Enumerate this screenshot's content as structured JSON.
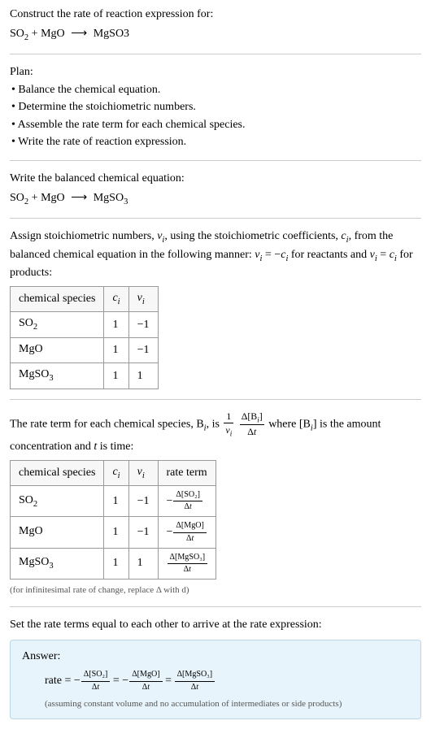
{
  "prompt": {
    "line1": "Construct the rate of reaction expression for:",
    "equation_lhs1": "SO",
    "equation_lhs1_sub": "2",
    "plus": " + ",
    "equation_lhs2": "MgO",
    "arrow": "⟶",
    "equation_rhs": "MgSO3"
  },
  "plan": {
    "heading": "Plan:",
    "bullets": [
      "• Balance the chemical equation.",
      "• Determine the stoichiometric numbers.",
      "• Assemble the rate term for each chemical species.",
      "• Write the rate of reaction expression."
    ]
  },
  "balanced": {
    "heading": "Write the balanced chemical equation:",
    "lhs1": "SO",
    "lhs1_sub": "2",
    "plus": " + ",
    "lhs2": "MgO",
    "arrow": "⟶",
    "rhs": "MgSO",
    "rhs_sub": "3"
  },
  "stoich": {
    "intro_a": "Assign stoichiometric numbers, ",
    "nu": "ν",
    "sub_i": "i",
    "intro_b": ", using the stoichiometric coefficients, ",
    "c": "c",
    "intro_c": ", from the balanced chemical equation in the following manner: ",
    "eq1_lhs": "ν",
    "eq1_eq": " = −",
    "eq1_rhs": "c",
    "intro_d": " for reactants and ",
    "eq2": " = ",
    "intro_e": " for products:",
    "table": {
      "headers": [
        "chemical species",
        "cᵢ",
        "νᵢ"
      ],
      "h0": "chemical species",
      "h1_base": "c",
      "h1_sub": "i",
      "h2_base": "ν",
      "h2_sub": "i",
      "rows": [
        {
          "species_base": "SO",
          "species_sub": "2",
          "c": "1",
          "nu": "−1"
        },
        {
          "species_base": "MgO",
          "species_sub": "",
          "c": "1",
          "nu": "−1"
        },
        {
          "species_base": "MgSO",
          "species_sub": "3",
          "c": "1",
          "nu": "1"
        }
      ]
    }
  },
  "rateterm": {
    "intro_a": "The rate term for each chemical species, B",
    "sub_i": "i",
    "intro_b": ", is ",
    "frac1_num": "1",
    "frac1_den_base": "ν",
    "frac2_num_a": "Δ[B",
    "frac2_num_b": "]",
    "frac2_den": "Δt",
    "intro_c": " where [B",
    "intro_d": "] is the amount concentration and ",
    "t": "t",
    "intro_e": " is time:",
    "table": {
      "h0": "chemical species",
      "h1_base": "c",
      "h1_sub": "i",
      "h2_base": "ν",
      "h2_sub": "i",
      "h3": "rate term",
      "rows": [
        {
          "species_base": "SO",
          "species_sub": "2",
          "c": "1",
          "nu": "−1",
          "rt_neg": "−",
          "rt_num": "Δ[SO₂]",
          "rt_den": "Δt"
        },
        {
          "species_base": "MgO",
          "species_sub": "",
          "c": "1",
          "nu": "−1",
          "rt_neg": "−",
          "rt_num": "Δ[MgO]",
          "rt_den": "Δt"
        },
        {
          "species_base": "MgSO",
          "species_sub": "3",
          "c": "1",
          "nu": "1",
          "rt_neg": "",
          "rt_num": "Δ[MgSO₃]",
          "rt_den": "Δt"
        }
      ]
    },
    "note": "(for infinitesimal rate of change, replace Δ with d)"
  },
  "final": {
    "heading": "Set the rate terms equal to each other to arrive at the rate expression:"
  },
  "answer": {
    "label": "Answer:",
    "rate": "rate = ",
    "neg": "−",
    "t1_num": "Δ[SO₂]",
    "t1_den": "Δt",
    "eq": " = ",
    "t2_num": "Δ[MgO]",
    "t2_den": "Δt",
    "t3_num": "Δ[MgSO₃]",
    "t3_den": "Δt",
    "assumption": "(assuming constant volume and no accumulation of intermediates or side products)"
  }
}
